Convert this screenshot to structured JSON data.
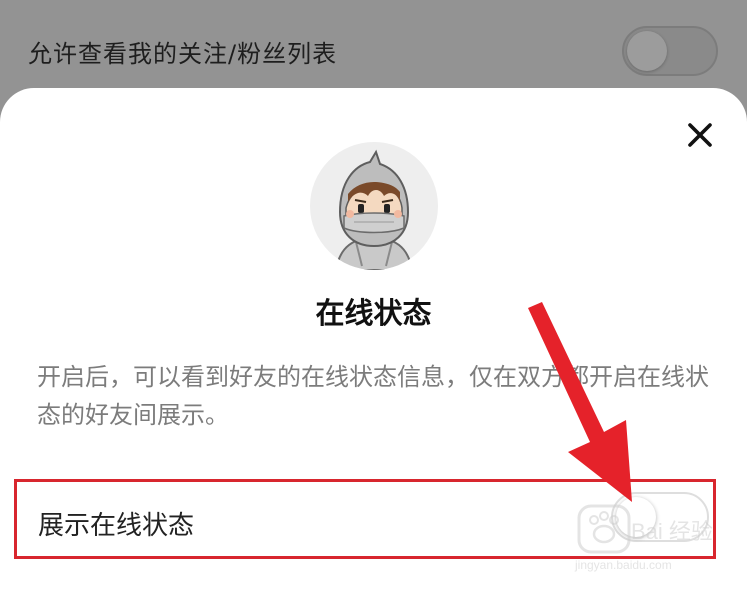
{
  "background_row": {
    "label": "允许查看我的关注/粉丝列表",
    "toggle_on": false
  },
  "dialog": {
    "close_icon": "close-icon",
    "avatar_icon": "ninja-avatar",
    "title": "在线状态",
    "description": "开启后，可以看到好友的在线状态信息，仅在双方都开启在线状态的好友间展示。",
    "setting": {
      "label": "展示在线状态",
      "toggle_on": false
    }
  },
  "annotations": {
    "highlight_color": "#d8262e",
    "arrow_color": "#e5222a"
  },
  "watermark": {
    "text": "Bai 经验",
    "sub": "jingyan.baidu.com"
  }
}
